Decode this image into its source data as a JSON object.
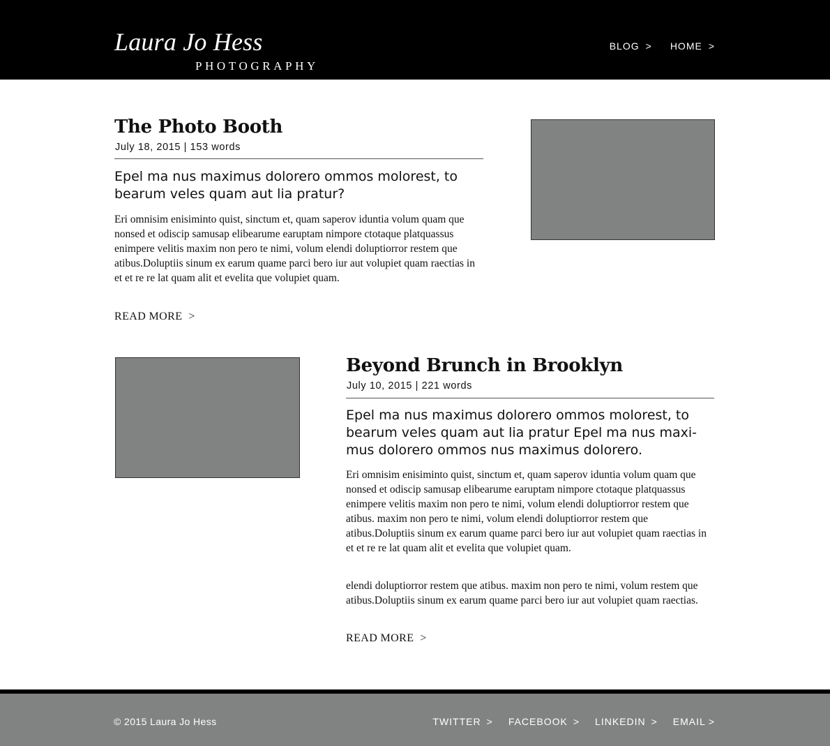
{
  "header": {
    "brand_name": "Laura Jo Hess",
    "brand_sub": "PHOTOGRAPHY",
    "nav": [
      {
        "label": "BLOG",
        "chevron": ">"
      },
      {
        "label": "HOME",
        "chevron": ">"
      }
    ]
  },
  "posts": [
    {
      "title": "The Photo Booth",
      "meta": "July 18, 2015 | 153 words",
      "lead": "Epel ma nus maximus dolorero ommos molorest, to bearum veles quam aut lia pratur?",
      "body": [
        "Eri omnisim enisiminto quist, sinctum et, quam saperov iduntia volum quam que nonsed et odiscip samusap elibearume earuptam nimpore ctotaque platquassus enimpere velitis maxim non pero te nimi, volum elendi doluptiorror restem que atibus.Doluptiis sinum ex earum quame parci bero iur aut volupiet quam raectias in et et re re lat quam alit et evelita que volupiet quam."
      ],
      "read_more": "READ MORE",
      "chevron": ">"
    },
    {
      "title": "Beyond Brunch in Brooklyn",
      "meta": "July 10, 2015 | 221 words",
      "lead": "Epel ma nus maximus dolorero ommos molorest, to bearum veles quam aut lia pratur Epel ma nus maxi-mus dolorero ommos nus maximus dolorero.",
      "body": [
        "Eri omnisim enisiminto quist, sinctum et, quam saperov iduntia volum quam que nonsed et odiscip samusap elibearume earuptam nimpore ctotaque platquassus enimpere velitis maxim non pero te nimi, volum elendi doluptiorror restem que atibus. maxim non pero te nimi, volum elendi doluptiorror restem que atibus.Doluptiis sinum ex earum quame parci bero iur aut volupiet quam raectias in et et re re lat quam alit et evelita que volupiet quam.",
        "elendi doluptiorror restem que atibus. maxim non pero te nimi, volum restem que atibus.Doluptiis sinum ex earum quame parci bero iur aut volupiet quam raectias."
      ],
      "read_more": "READ MORE",
      "chevron": ">"
    }
  ],
  "footer": {
    "copyright": "© 2015 Laura Jo Hess",
    "links": [
      {
        "label": "TWITTER",
        "chevron": ">"
      },
      {
        "label": "FACEBOOK",
        "chevron": ">"
      },
      {
        "label": "LINKEDIN",
        "chevron": ">"
      },
      {
        "label": "EMAIL",
        "chevron": ">"
      }
    ]
  },
  "colors": {
    "header_bg": "#000000",
    "footer_bg": "#818382",
    "photo_placeholder": "#818382",
    "text": "#111111"
  }
}
